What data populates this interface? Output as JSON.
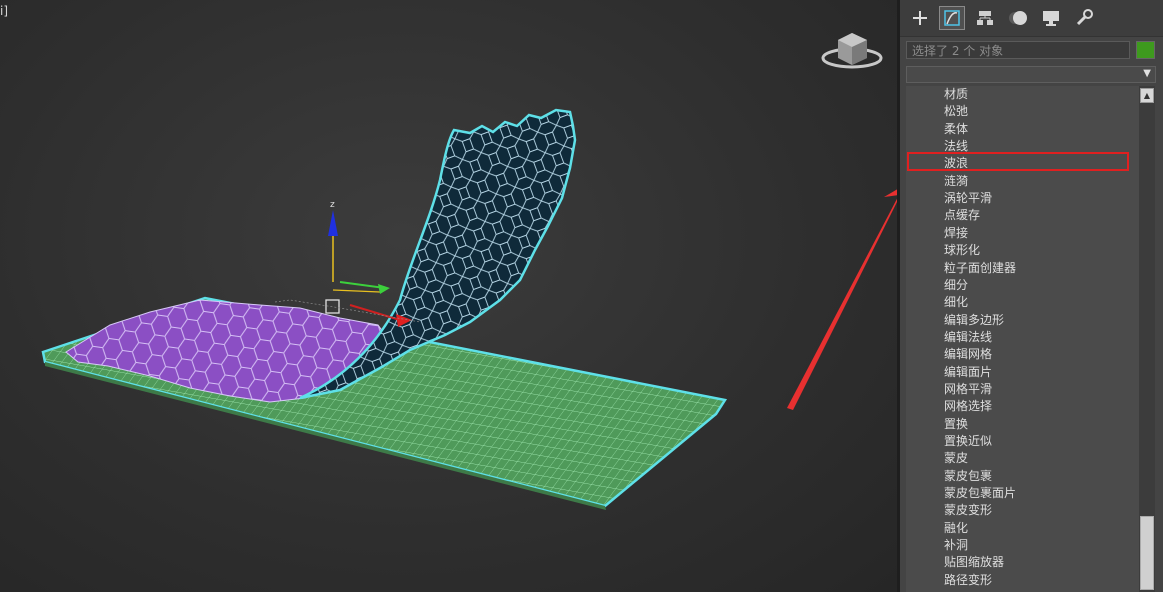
{
  "viewport": {
    "label": "i]"
  },
  "panel": {
    "tabs": [
      {
        "icon": "create-plus-icon"
      },
      {
        "icon": "modify-icon"
      },
      {
        "icon": "hierarchy-icon"
      },
      {
        "icon": "motion-icon"
      },
      {
        "icon": "display-icon"
      },
      {
        "icon": "utilities-wrench-icon"
      }
    ],
    "selection_text": "选择了 2 个 对象",
    "object_color": "#3e9a1e",
    "modifier_list_value": ""
  },
  "modifier_list": {
    "items": [
      "材质",
      "松弛",
      "柔体",
      "法线",
      "波浪",
      "涟漪",
      "涡轮平滑",
      "点缓存",
      "焊接",
      "球形化",
      "粒子面创建器",
      "细分",
      "细化",
      "编辑多边形",
      "编辑法线",
      "编辑网格",
      "编辑面片",
      "网格平滑",
      "网格选择",
      "置换",
      "置换近似",
      "蒙皮",
      "蒙皮包裹",
      "蒙皮包裹面片",
      "蒙皮变形",
      "融化",
      "补洞",
      "贴图缩放器",
      "路径变形"
    ],
    "highlighted": "波浪"
  },
  "annotation": {
    "arrow_color": "#e83030",
    "box_color": "#e02020"
  },
  "colors": {
    "grid_green": "#4f9a5a",
    "selection_cyan": "#5ee0e8",
    "purple_fill": "#8b4fc4",
    "dark_blue_fill": "#0f2a3a"
  }
}
